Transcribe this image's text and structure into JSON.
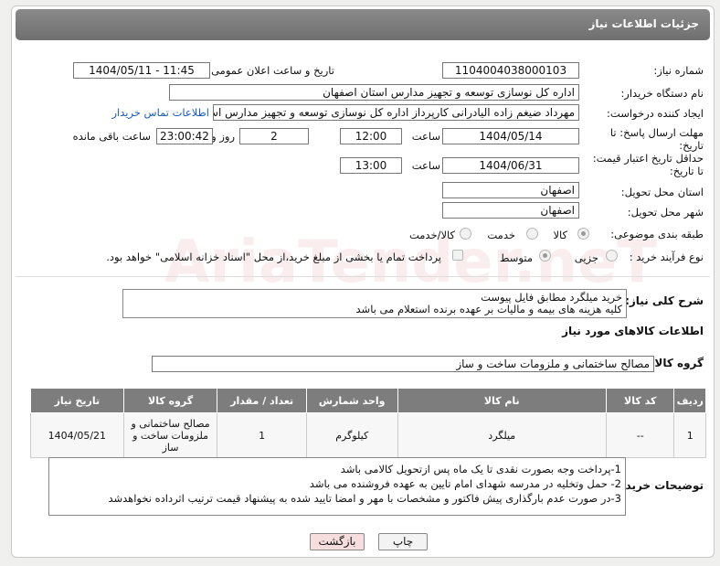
{
  "header": {
    "title": "جزئیات اطلاعات نیاز"
  },
  "fields": {
    "need_number_label": "شماره نیاز:",
    "need_number": "1104004038000103",
    "announce_label": "تاریخ و ساعت اعلان عمومی:",
    "announce_value": "1404/05/11 - 11:45",
    "buyer_org_label": "نام دستگاه خریدار:",
    "buyer_org": "اداره کل نوسازی  توسعه و تجهیز مدارس استان اصفهان",
    "requester_label": "ایجاد کننده درخواست:",
    "requester": "مهرداد ضیغم زاده الیادرانی کارپرداز اداره کل نوسازی  توسعه و تجهیز مدارس استان اصفهان",
    "contact_link": "اطلاعات تماس خریدار",
    "deadline_label": "مهلت ارسال پاسخ: تا تاریخ:",
    "deadline_date": "1404/05/14",
    "time_label": "ساعت",
    "deadline_time": "12:00",
    "days_value": "2",
    "days_label": "روز و",
    "remaining_time": "23:00:42",
    "remaining_label": "ساعت باقی مانده",
    "price_validity_label": "حداقل تاریخ اعتبار قیمت: تا تاریخ:",
    "price_date": "1404/06/31",
    "price_time_label": "ساعت",
    "price_time": "13:00",
    "province_label": "استان محل تحویل:",
    "province": "اصفهان",
    "city_label": "شهر محل تحویل:",
    "city": "اصفهان",
    "category_label": "طبقه بندی موضوعی:",
    "category_options": [
      "کالا",
      "خدمت",
      "کالا/خدمت"
    ],
    "process_label": "نوع فرآیند خرید :",
    "process_options": [
      "جزیی",
      "متوسط"
    ],
    "payment_note": "پرداخت تمام یا بخشی از مبلغ خرید،از محل \"اسناد خزانه اسلامی\" خواهد بود."
  },
  "description": {
    "label": "شرح کلی نیاز:",
    "line1": "خرید میلگرد مطابق فایل پیوست",
    "line2": "کلیه هزینه های بیمه و مالیات بر عهده برنده استعلام می باشد"
  },
  "goods": {
    "section_title": "اطلاعات کالاهای مورد نیاز",
    "group_label": "گروه کالا:",
    "group_value": "مصالح ساختمانی و ملزومات ساخت و ساز",
    "columns": [
      "ردیف",
      "کد کالا",
      "نام کالا",
      "واحد شمارش",
      "تعداد / مقدار",
      "گروه کالا",
      "تاریخ نیاز"
    ],
    "row": {
      "index": "1",
      "code": "--",
      "name": "میلگرد",
      "unit": "کیلوگرم",
      "qty": "1",
      "group": "مصالح ساختمانی و ملزومات ساخت و ساز",
      "date": "1404/05/21"
    }
  },
  "buyer_notes": {
    "label": "توضیحات خریدار:",
    "line1": "1-پرداخت وجه بصورت نقدی تا یک ماه پس ازتحویل کالامی باشد",
    "line2": "2- حمل وتخلیه در مدرسه شهدای امام تایین به عهده فروشنده می باشد",
    "line3": "3-در صورت عدم بارگذاری پیش فاکتور و مشخصات با مهر و امضا تایید شده به پیشنهاد قیمت ترتیب اثرداده نخواهدشد"
  },
  "buttons": {
    "print": "چاپ",
    "back": "بازگشت"
  },
  "watermark": "AriaTender.neT"
}
